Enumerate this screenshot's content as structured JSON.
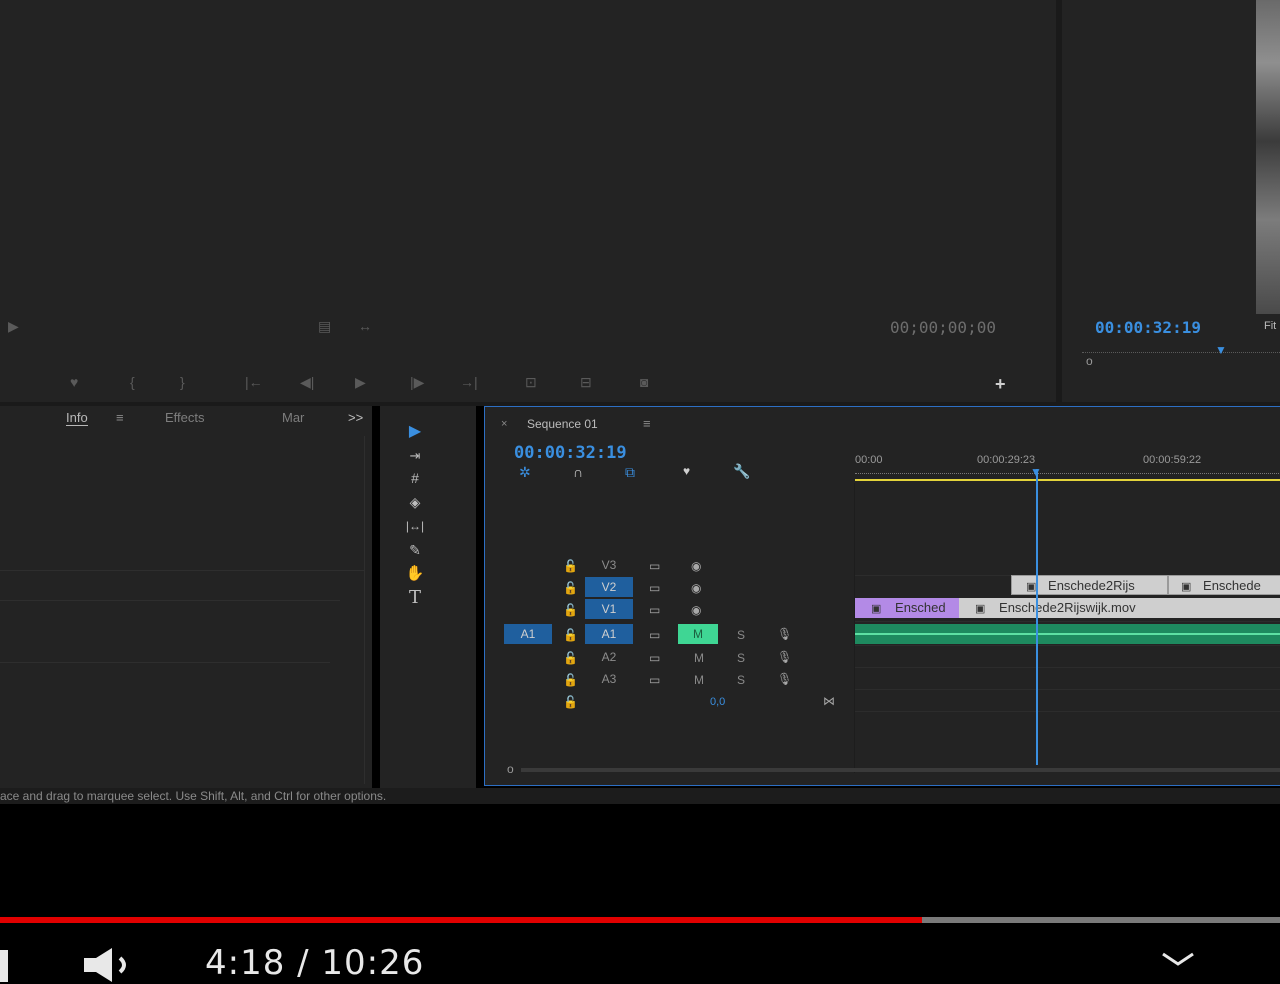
{
  "source_monitor": {
    "timecode": "00;00;00;00"
  },
  "program_monitor": {
    "timecode": "00:00:32:19",
    "fit_label": "Fit"
  },
  "panels": {
    "tabs": [
      {
        "label": "Info"
      },
      {
        "label": "Effects"
      },
      {
        "label": "Mar"
      }
    ],
    "overflow": ">>"
  },
  "timeline": {
    "sequence_name": "Sequence 01",
    "timecode": "00:00:32:19",
    "ruler": [
      "00:00",
      "00:00:29:23",
      "00:00:59:22"
    ],
    "tracks": [
      {
        "source": "",
        "label": "V3",
        "active": false
      },
      {
        "source": "",
        "label": "V2",
        "active": true
      },
      {
        "source": "",
        "label": "V1",
        "active": true
      },
      {
        "source": "A1",
        "label": "A1",
        "active": true,
        "mute": "M",
        "solo": "S"
      },
      {
        "source": "",
        "label": "A2",
        "active": false,
        "mute": "M",
        "solo": "S"
      },
      {
        "source": "",
        "label": "A3",
        "active": false,
        "mute": "M",
        "solo": "S"
      }
    ],
    "master_value": "0,0",
    "clips": {
      "v2_a": "Enschede2Rijs",
      "v2_b": "Enschede",
      "v1_a": "Ensched",
      "v1_b": "Enschede2Rijswijk.mov"
    }
  },
  "status_bar": {
    "text": "ace and drag to marquee select. Use Shift, Alt, and Ctrl for other options."
  },
  "player": {
    "time": "4:18 / 10:26",
    "progress_fraction": 0.72
  }
}
